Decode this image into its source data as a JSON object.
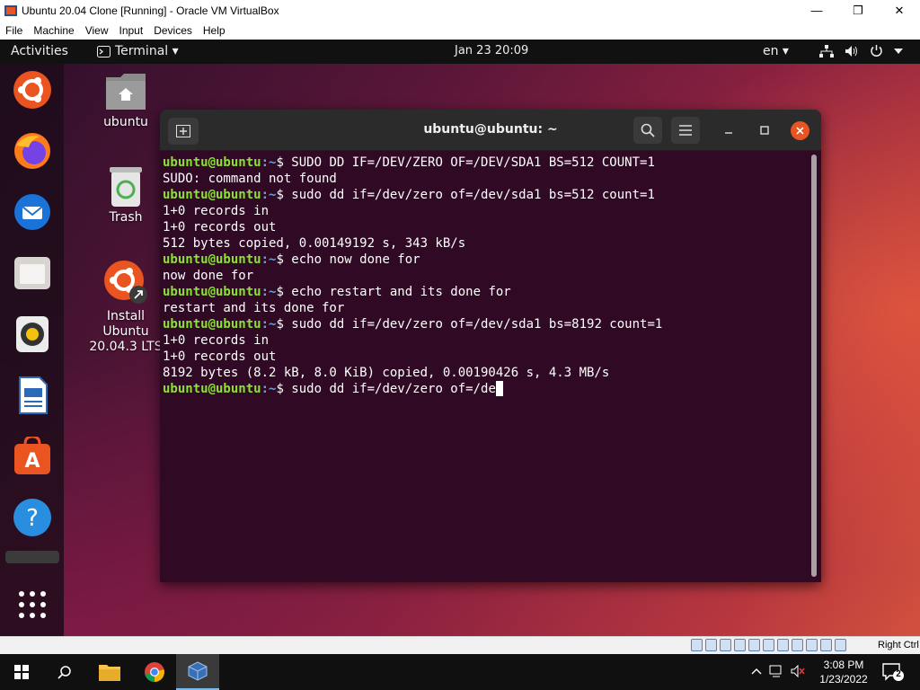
{
  "window": {
    "title": "Ubuntu 20.04 Clone [Running] - Oracle VM VirtualBox",
    "minimize": "—",
    "maximize": "❐",
    "close": "✕"
  },
  "menubar": [
    "File",
    "Machine",
    "View",
    "Input",
    "Devices",
    "Help"
  ],
  "topbar": {
    "activities": "Activities",
    "app_menu": "Terminal ▾",
    "clock": "Jan 23  20:09",
    "language": "en ▾"
  },
  "desktop": {
    "home_label": "ubuntu",
    "trash_label": "Trash",
    "installer_label": "Install Ubuntu 20.04.3 LTS"
  },
  "terminal": {
    "title": "ubuntu@ubuntu: ~",
    "prompt_user": "ubuntu@ubuntu",
    "prompt_path": ":~",
    "lines": [
      {
        "type": "cmd",
        "text": "$ SUDO DD IF=/DEV/ZERO OF=/DEV/SDA1 BS=512 COUNT=1"
      },
      {
        "type": "out",
        "text": "SUDO: command not found"
      },
      {
        "type": "cmd",
        "text": "$ sudo dd if=/dev/zero of=/dev/sda1 bs=512 count=1"
      },
      {
        "type": "out",
        "text": "1+0 records in"
      },
      {
        "type": "out",
        "text": "1+0 records out"
      },
      {
        "type": "out",
        "text": "512 bytes copied, 0.00149192 s, 343 kB/s"
      },
      {
        "type": "cmd",
        "text": "$ echo now done for"
      },
      {
        "type": "out",
        "text": "now done for"
      },
      {
        "type": "cmd",
        "text": "$ echo restart and its done for"
      },
      {
        "type": "out",
        "text": "restart and its done for"
      },
      {
        "type": "cmd",
        "text": "$ sudo dd if=/dev/zero of=/dev/sda1 bs=8192 count=1"
      },
      {
        "type": "out",
        "text": "1+0 records in"
      },
      {
        "type": "out",
        "text": "1+0 records out"
      },
      {
        "type": "out",
        "text": "8192 bytes (8.2 kB, 8.0 KiB) copied, 0.00190426 s, 4.3 MB/s"
      },
      {
        "type": "input",
        "text": "$ sudo dd if=/dev/zero of=/de"
      }
    ]
  },
  "vbox_status": {
    "host_key": "Right Ctrl"
  },
  "taskbar": {
    "time": "3:08 PM",
    "date": "1/23/2022",
    "notification_count": "2"
  },
  "colors": {
    "terminal_bg": "#300a24",
    "prompt_user": "#8ae234",
    "prompt_path": "#729fcf",
    "ubuntu_orange": "#e95420"
  }
}
